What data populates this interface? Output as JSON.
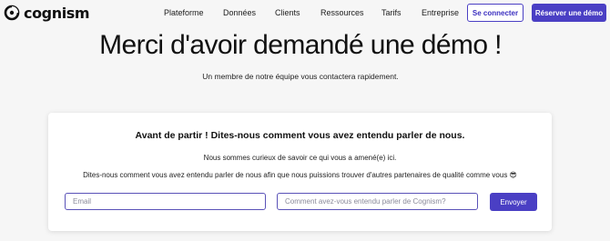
{
  "brand": {
    "name": "cognism",
    "logo_icon": "cognism-logo-icon",
    "color": "#4a3fc4"
  },
  "nav": {
    "items": [
      {
        "label": "Plateforme"
      },
      {
        "label": "Données"
      },
      {
        "label": "Clients"
      },
      {
        "label": "Ressources"
      },
      {
        "label": "Tarifs"
      },
      {
        "label": "Entreprise"
      }
    ],
    "login_label": "Se connecter",
    "demo_label": "Réserver une démo"
  },
  "hero": {
    "title": "Merci d'avoir demandé une démo !",
    "subtitle": "Un membre de notre équipe vous contactera rapidement."
  },
  "survey": {
    "title": "Avant de partir ! Dites-nous comment vous avez entendu parler de nous.",
    "line1": "Nous sommes curieux de savoir ce qui vous a amené(e) ici.",
    "line2": "Dites-nous comment vous avez entendu parler de nous afin que nous puissions trouver d'autres partenaires de qualité comme vous 😎",
    "email_placeholder": "Email",
    "source_placeholder": "Comment avez-vous entendu parler de Cognism?",
    "submit_label": "Envoyer"
  }
}
